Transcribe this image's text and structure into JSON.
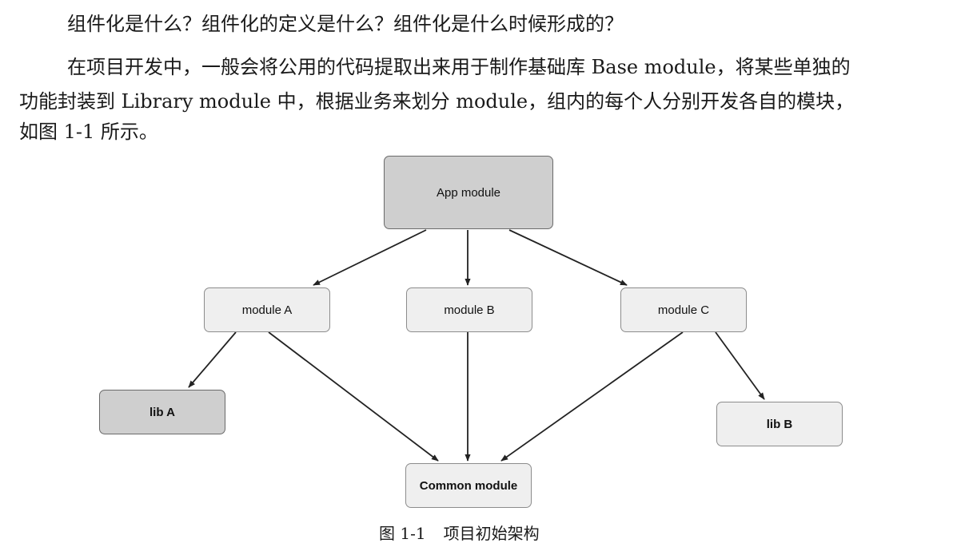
{
  "text": {
    "question": "组件化是什么？组件化的定义是什么？组件化是什么时候形成的？",
    "paragraph_lines": [
      "在项目开发中，一般会将公用的代码提取出来用于制作基础库 Base module，将某些单独的",
      "功能封装到 Library module 中，根据业务来划分 module，组内的每个人分别开发各自的模块，",
      "如图 1-1 所示。"
    ]
  },
  "figure": {
    "nodes": {
      "app": "App module",
      "module_a": "module A",
      "module_b": "module B",
      "module_c": "module C",
      "lib_a": "lib A",
      "lib_b": "lib B",
      "common": "Common module"
    },
    "edges": [
      [
        "app",
        "module_a"
      ],
      [
        "app",
        "module_b"
      ],
      [
        "app",
        "module_c"
      ],
      [
        "module_a",
        "lib_a"
      ],
      [
        "module_a",
        "common"
      ],
      [
        "module_b",
        "common"
      ],
      [
        "module_c",
        "common"
      ],
      [
        "module_c",
        "lib_b"
      ]
    ],
    "caption_number": "图 1-1",
    "caption_title": "项目初始架构"
  }
}
